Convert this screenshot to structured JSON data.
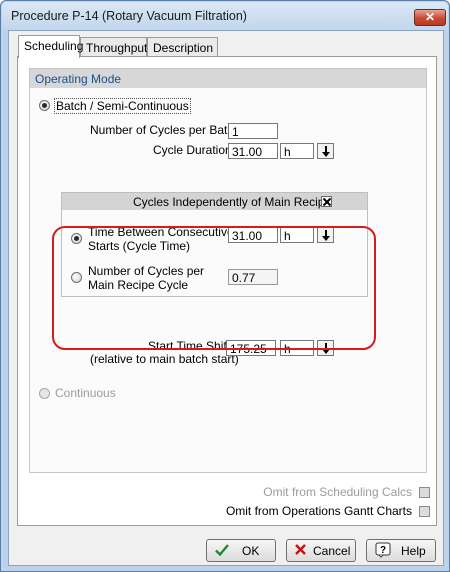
{
  "window": {
    "title": "Procedure P-14 (Rotary Vacuum Filtration)",
    "close_glyph": "✕"
  },
  "tabs": [
    {
      "label": "Scheduling",
      "active": true
    },
    {
      "label": "Throughput",
      "active": false
    },
    {
      "label": "Description",
      "active": false
    }
  ],
  "operating_mode": {
    "group_title": "Operating Mode",
    "batch_label": "Batch / Semi-Continuous",
    "batch_selected": true,
    "cycles_per_batch_label": "Number of Cycles per Batch",
    "cycles_per_batch_value": "1",
    "cycle_duration_label": "Cycle Duration",
    "cycle_duration_value": "31.00",
    "cycle_duration_unit": "h",
    "independent": {
      "title": "Cycles Independently of Main Recipe",
      "checked": true,
      "option1_line1": "Time Between Consecutive",
      "option1_line2": "Starts (Cycle Time)",
      "option1_selected": true,
      "cycle_time_value": "31.00",
      "cycle_time_unit": "h",
      "option2_line1": "Number of Cycles per",
      "option2_line2": "Main Recipe Cycle",
      "option2_selected": false,
      "cycles_per_main_value": "0.77"
    },
    "start_shift_label": "Start Time Shift",
    "start_shift_sub": "(relative to main batch start)",
    "start_shift_value": "175.25",
    "start_shift_unit": "h",
    "continuous_label": "Continuous",
    "continuous_selected": false
  },
  "options": {
    "omit_scheduling_label": "Omit from Scheduling Calcs",
    "omit_gantt_label": "Omit from Operations Gantt Charts"
  },
  "buttons": {
    "ok": "OK",
    "cancel": "Cancel",
    "help": "Help"
  },
  "colors": {
    "accent_red": "#d41c1c",
    "group_title_text": "#1c4f8c",
    "ok_check": "#1e8a2e",
    "cancel_x": "#c21414"
  }
}
